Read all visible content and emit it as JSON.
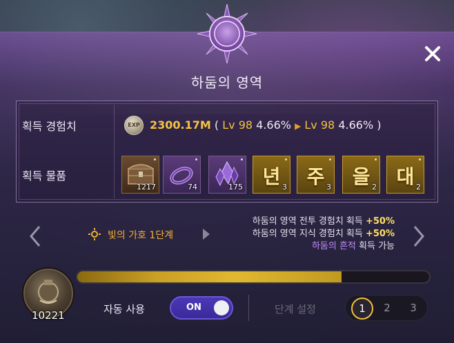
{
  "dialog": {
    "title": "하둠의 영역"
  },
  "rewards": {
    "exp_label": "획득 경험치",
    "exp_icon_text": "EXP",
    "exp_amount": "2300.17M",
    "exp_open": "( ",
    "lv_from": "Lv 98",
    "pct_from": "4.66%",
    "lv_to": "Lv 98",
    "pct_to": "4.66%",
    "exp_close": " )",
    "items_label": "획득 물품",
    "items": [
      {
        "kind": "chest",
        "count": "1217"
      },
      {
        "kind": "bracelet",
        "count": "74"
      },
      {
        "kind": "crystal",
        "count": "175"
      },
      {
        "kind": "glyph",
        "glyph": "년",
        "count": "3"
      },
      {
        "kind": "glyph",
        "glyph": "주",
        "count": "3"
      },
      {
        "kind": "glyph",
        "glyph": "을",
        "count": "2"
      },
      {
        "kind": "glyph",
        "glyph": "대",
        "count": "2"
      }
    ]
  },
  "buff": {
    "name": "빛의 가호 1단계",
    "line1_text": "하둠의 영역 전투 경험치 획득 ",
    "line1_pct": "+50%",
    "line2_text": "하둠의 영역 지식 경험치 획득 ",
    "line2_pct": "+50%",
    "line3_highlight": "하둠의 흔적",
    "line3_text": " 획득 가능"
  },
  "bottom": {
    "progress_fraction": 0.75,
    "potion_count": "10221",
    "auto_use_label": "자동 사용",
    "toggle_label": "ON",
    "stage_label": "단계 설정",
    "stages": [
      "1",
      "2",
      "3"
    ],
    "active_stage": "1"
  },
  "colors": {
    "accent_gold": "#f5c242",
    "accent_purple": "#c08cf8",
    "toggle_blue": "#4a38b8"
  },
  "icons": {
    "close": "close-icon",
    "emblem": "sun-moon-emblem-icon",
    "prev": "chevron-left-icon",
    "next": "chevron-right-icon",
    "buff": "sun-icon"
  }
}
